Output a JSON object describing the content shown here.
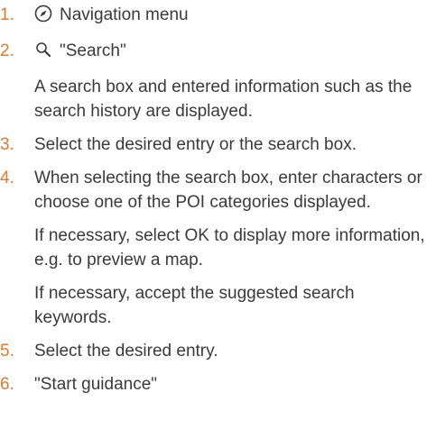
{
  "colors": {
    "step_number": "#e07a2c",
    "text": "#3a3a3a"
  },
  "steps": [
    {
      "number": "1.",
      "icon": "navigation-compass-icon",
      "text": "Navigation menu"
    },
    {
      "number": "2.",
      "icon": "search-icon",
      "text": "\"Search\"",
      "note": "A search box and entered information such as the search history are displayed."
    },
    {
      "number": "3.",
      "text": "Select the desired entry or the search box."
    },
    {
      "number": "4.",
      "text": "When selecting the search box, enter characters or choose one of the POI categories displayed.",
      "note_prefix": "If necessary, select",
      "ok_label": "OK",
      "note_suffix": "to display more information, e.g. to preview a map.",
      "note2": "If necessary, accept the suggested search keywords."
    },
    {
      "number": "5.",
      "text": "Select the desired entry."
    },
    {
      "number": "6.",
      "text": "\"Start guidance\""
    }
  ]
}
